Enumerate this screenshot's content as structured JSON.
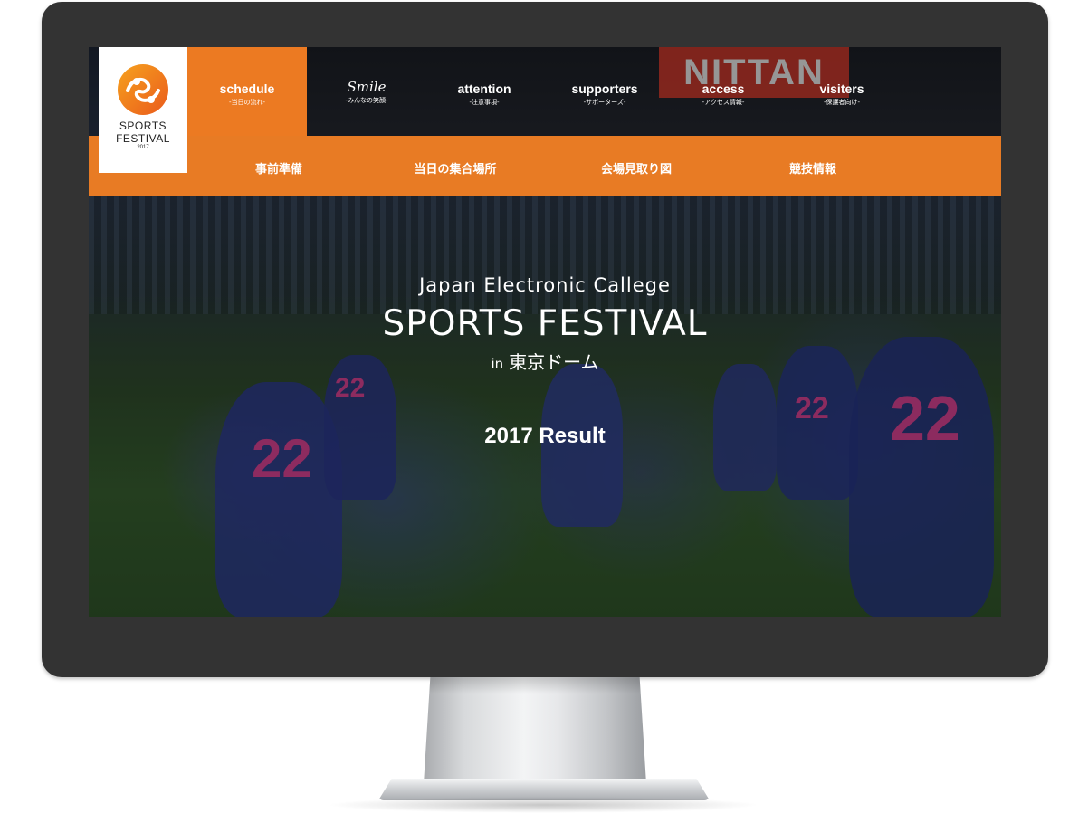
{
  "header": {
    "logo": {
      "title_line1": "SPORTS",
      "title_line2": "FESTIVAL",
      "year": "2017",
      "icon": "festival-logo-icon",
      "accent_color": "#ef7f1a"
    },
    "nav": [
      {
        "label": "schedule",
        "sub": "-当日の流れ-"
      },
      {
        "label": "Smile",
        "sub": "-みんなの笑顔-"
      },
      {
        "label": "attention",
        "sub": "-注意事項-"
      },
      {
        "label": "supporters",
        "sub": "-サポーターズ-"
      },
      {
        "label": "access",
        "sub": "-アクセス情報-"
      },
      {
        "label": "visiters",
        "sub": "-保護者向け-"
      }
    ],
    "subnav": [
      {
        "label": "事前準備"
      },
      {
        "label": "当日の集合場所"
      },
      {
        "label": "会場見取り図"
      },
      {
        "label": "競技情報"
      }
    ],
    "brand_color": "#ec7a22"
  },
  "hero": {
    "subtitle": "Japan Electronic Callege",
    "title": "SPORTS FESTIVAL",
    "venue_prefix": "in",
    "venue": "東京ドーム",
    "result": "2017 Result"
  },
  "background": {
    "scoreboard_text": "NITTAN",
    "jersey_number": "22"
  }
}
